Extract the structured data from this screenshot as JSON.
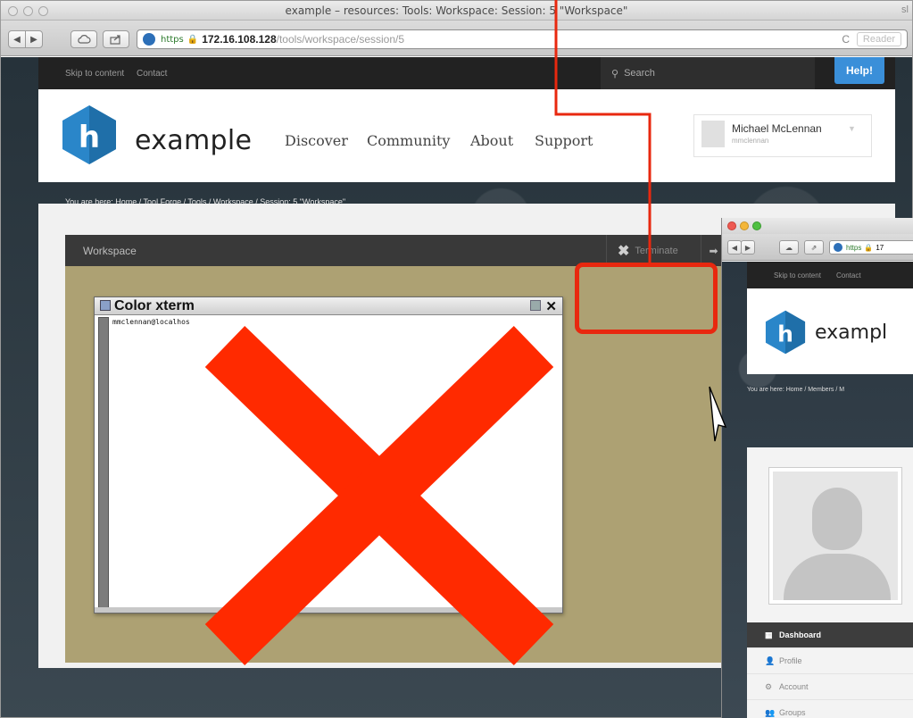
{
  "browser": {
    "window_title": "example – resources: Tools: Workspace: Session: 5 \"Workspace\"",
    "window_title_right": "sl",
    "address": {
      "scheme": "https",
      "host": "172.16.108.128",
      "path": "/tools/workspace/session/5"
    },
    "reader_label": "Reader",
    "reload_glyph": "C"
  },
  "site": {
    "topbar": {
      "skip": "Skip to content",
      "contact": "Contact",
      "search_placeholder": "Search",
      "help": "Help!"
    },
    "brand": "example",
    "nav": [
      "Discover",
      "Community",
      "About",
      "Support"
    ],
    "user": {
      "name": "Michael McLennan",
      "username": "mmclennan"
    },
    "breadcrumb": "You are here: Home / Tool Forge / Tools / Workspace / Session: 5 \"Workspace\""
  },
  "workspace": {
    "title": "Workspace",
    "terminate": "Terminate",
    "xterm": {
      "title": "Color xterm",
      "prompt": "mmclennan@localhos"
    }
  },
  "second_window": {
    "address": {
      "scheme": "https",
      "host": "17"
    },
    "topbar": {
      "skip": "Skip to content",
      "contact": "Contact"
    },
    "brand": "exampl",
    "breadcrumb": "You are here: Home / Members / M",
    "menu": [
      {
        "icon": "dashboard-icon",
        "label": "Dashboard",
        "active": true
      },
      {
        "icon": "profile-icon",
        "label": "Profile",
        "active": false
      },
      {
        "icon": "account-icon",
        "label": "Account",
        "active": false
      },
      {
        "icon": "groups-icon",
        "label": "Groups",
        "active": false
      }
    ]
  },
  "colors": {
    "annotation": "#e8280f",
    "x_mark": "#ff2a00",
    "workspace_bg": "#ada173",
    "help_blue": "#3a8fd9",
    "logo_blue": "#2a86c9"
  }
}
